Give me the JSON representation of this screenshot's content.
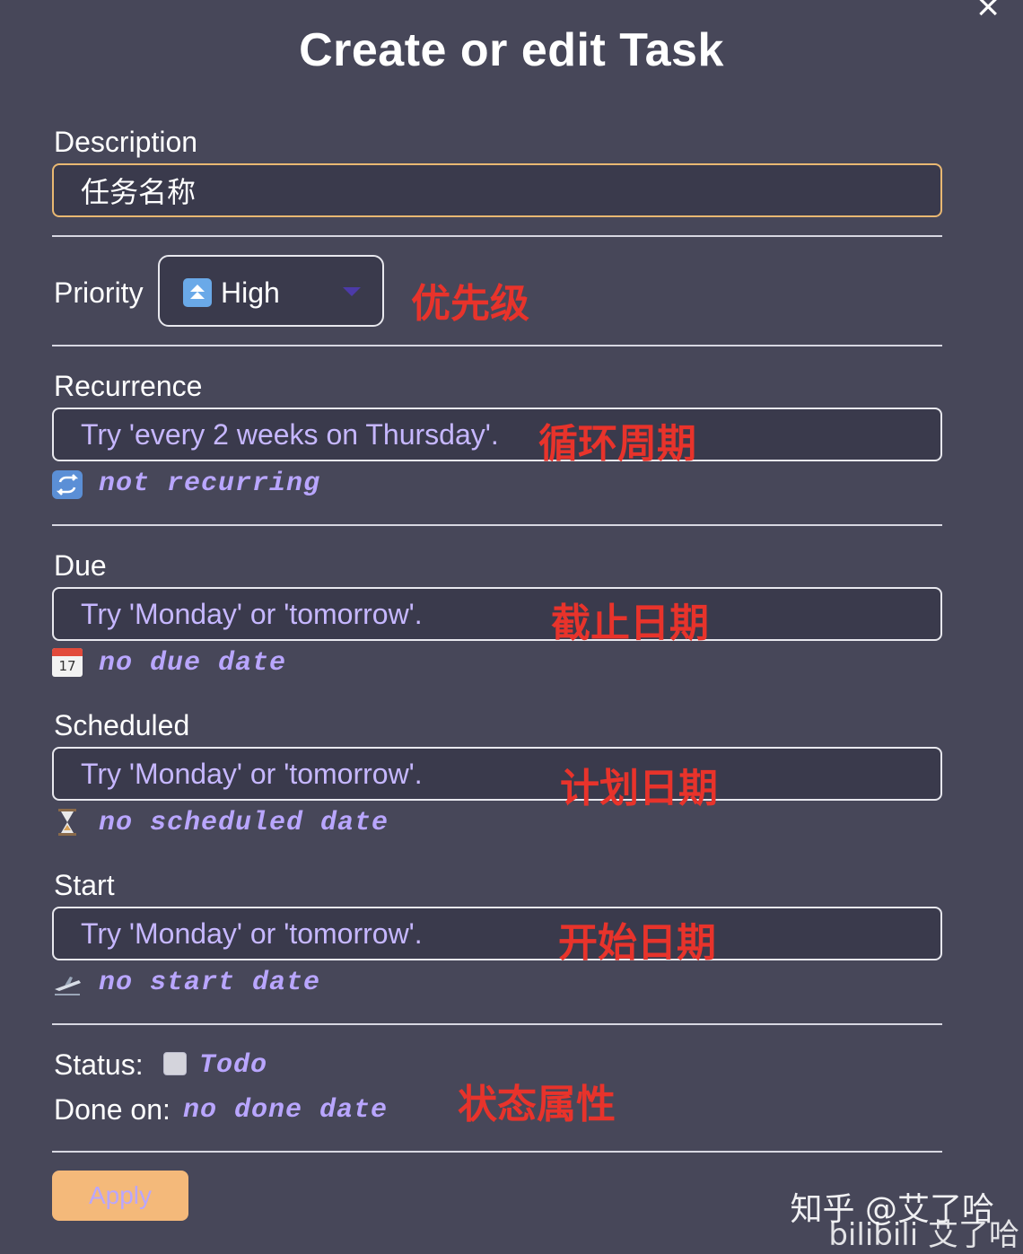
{
  "dialog": {
    "title": "Create or edit Task",
    "close_icon": "×"
  },
  "description": {
    "label": "Description",
    "value": "任务名称"
  },
  "priority": {
    "label": "Priority",
    "selected": "High",
    "icon_symbol": "⏫",
    "annotation": "优先级"
  },
  "recurrence": {
    "label": "Recurrence",
    "placeholder": "Try 'every 2 weeks on Thursday'.",
    "hint": "not recurring",
    "annotation": "循环周期"
  },
  "due": {
    "label": "Due",
    "placeholder": "Try 'Monday' or 'tomorrow'.",
    "hint": "no due date",
    "icon_day": "17",
    "annotation": "截止日期"
  },
  "scheduled": {
    "label": "Scheduled",
    "placeholder": "Try 'Monday' or 'tomorrow'.",
    "hint": "no scheduled date",
    "annotation": "计划日期"
  },
  "start": {
    "label": "Start",
    "placeholder": "Try 'Monday' or 'tomorrow'.",
    "hint": "no start date",
    "annotation": "开始日期"
  },
  "status": {
    "label": "Status:",
    "value": "Todo",
    "done_label": "Done on:",
    "done_value": "no done date",
    "annotation": "状态属性"
  },
  "apply_label": "Apply",
  "watermark": {
    "zhihu": "知乎 @艾了哈",
    "bilibili": "bilibili 艾了哈"
  }
}
